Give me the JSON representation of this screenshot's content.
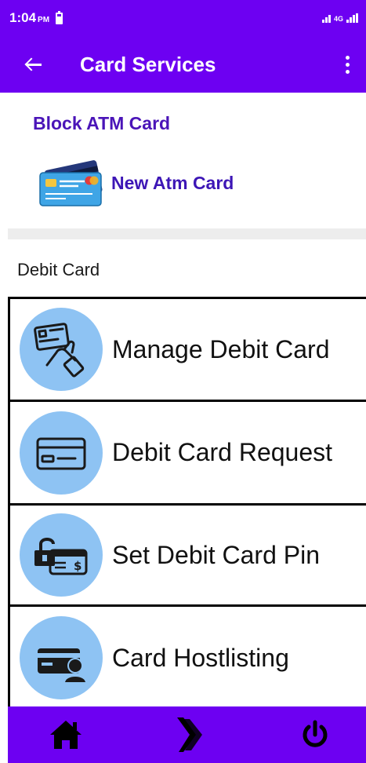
{
  "status_bar": {
    "time": "1:04",
    "period": "PM",
    "network": "4G"
  },
  "app_bar": {
    "title": "Card Services"
  },
  "links": {
    "block_atm": "Block ATM Card",
    "new_atm": "New Atm Card"
  },
  "section": {
    "label": "Debit Card"
  },
  "cards": [
    {
      "label": "Manage Debit Card",
      "icon": "hand-card-icon"
    },
    {
      "label": "Debit Card Request",
      "icon": "credit-card-icon"
    },
    {
      "label": "Set Debit Card Pin",
      "icon": "card-lock-icon"
    },
    {
      "label": "Card Hostlisting",
      "icon": "card-user-icon"
    }
  ],
  "bottom_nav": {
    "items": [
      "home-icon",
      "brand-logo-icon",
      "power-icon"
    ]
  },
  "colors": {
    "primary": "#6d00f2",
    "link": "#4a14b8",
    "circle": "#8ec3f3"
  }
}
